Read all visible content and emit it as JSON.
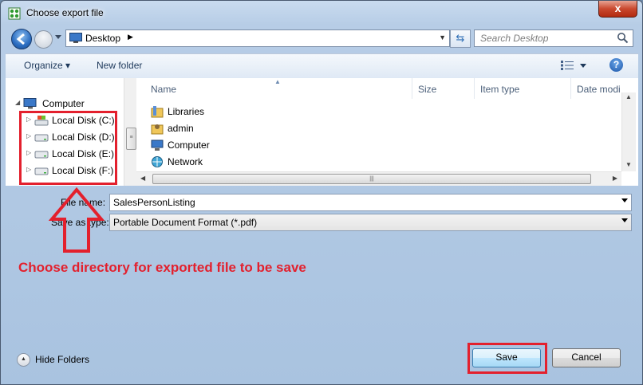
{
  "window": {
    "title": "Choose export file",
    "close_label": "x"
  },
  "address_bar": {
    "location": "Desktop",
    "search_placeholder": "Search Desktop"
  },
  "toolbar": {
    "organize_label": "Organize ▾",
    "new_folder_label": "New folder"
  },
  "nav_tree": {
    "root": "Computer",
    "items": [
      {
        "label": "Local Disk (C:)"
      },
      {
        "label": "Local Disk (D:)"
      },
      {
        "label": "Local Disk (E:)"
      },
      {
        "label": "Local Disk (F:)"
      }
    ]
  },
  "file_list": {
    "columns": [
      "Name",
      "Size",
      "Item type",
      "Date modi"
    ],
    "items": [
      {
        "name": "Libraries",
        "icon": "libraries-icon"
      },
      {
        "name": "admin",
        "icon": "user-folder-icon"
      },
      {
        "name": "Computer",
        "icon": "computer-icon"
      },
      {
        "name": "Network",
        "icon": "network-icon"
      }
    ]
  },
  "form": {
    "file_name_label": "File name:",
    "file_name_value": "SalesPersonListing",
    "save_type_label": "Save as type:",
    "save_type_value": "Portable Document Format (*.pdf)"
  },
  "annotation": {
    "text": "Choose directory for exported file to be save",
    "color": "#e3202d"
  },
  "footer": {
    "hide_folders_label": "Hide Folders",
    "save_label": "Save",
    "cancel_label": "Cancel"
  }
}
